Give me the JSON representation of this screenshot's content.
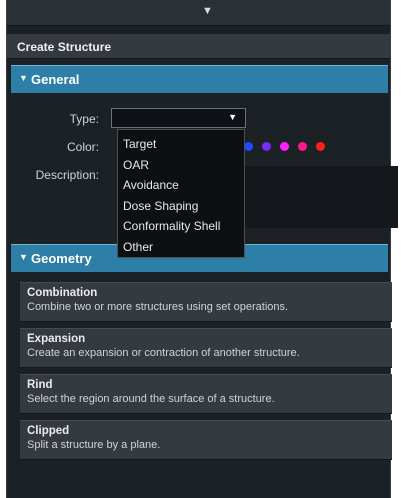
{
  "collapse_arrow": "▼",
  "panel_title": "Create Structure",
  "general": {
    "header": "General",
    "header_arrow": "▼",
    "type_label": "Type:",
    "type_value": "",
    "type_caret": "▼",
    "color_label": "Color:",
    "description_label": "Description:",
    "swatch_colors": [
      "#1e4bff",
      "#7a2bff",
      "#ff22ff",
      "#ff1a8c",
      "#ff1e1e"
    ],
    "type_options": [
      "Target",
      "OAR",
      "Avoidance",
      "Dose Shaping",
      "Conformality Shell",
      "Other"
    ]
  },
  "geometry": {
    "header": "Geometry",
    "header_arrow": "▼",
    "cards": [
      {
        "name": "Combination",
        "desc": "Combine two or more structures using set operations."
      },
      {
        "name": "Expansion",
        "desc": "Create an expansion or contraction of another structure."
      },
      {
        "name": "Rind",
        "desc": "Select the region around the surface of a structure."
      },
      {
        "name": "Clipped",
        "desc": "Split a structure by a plane."
      }
    ]
  }
}
